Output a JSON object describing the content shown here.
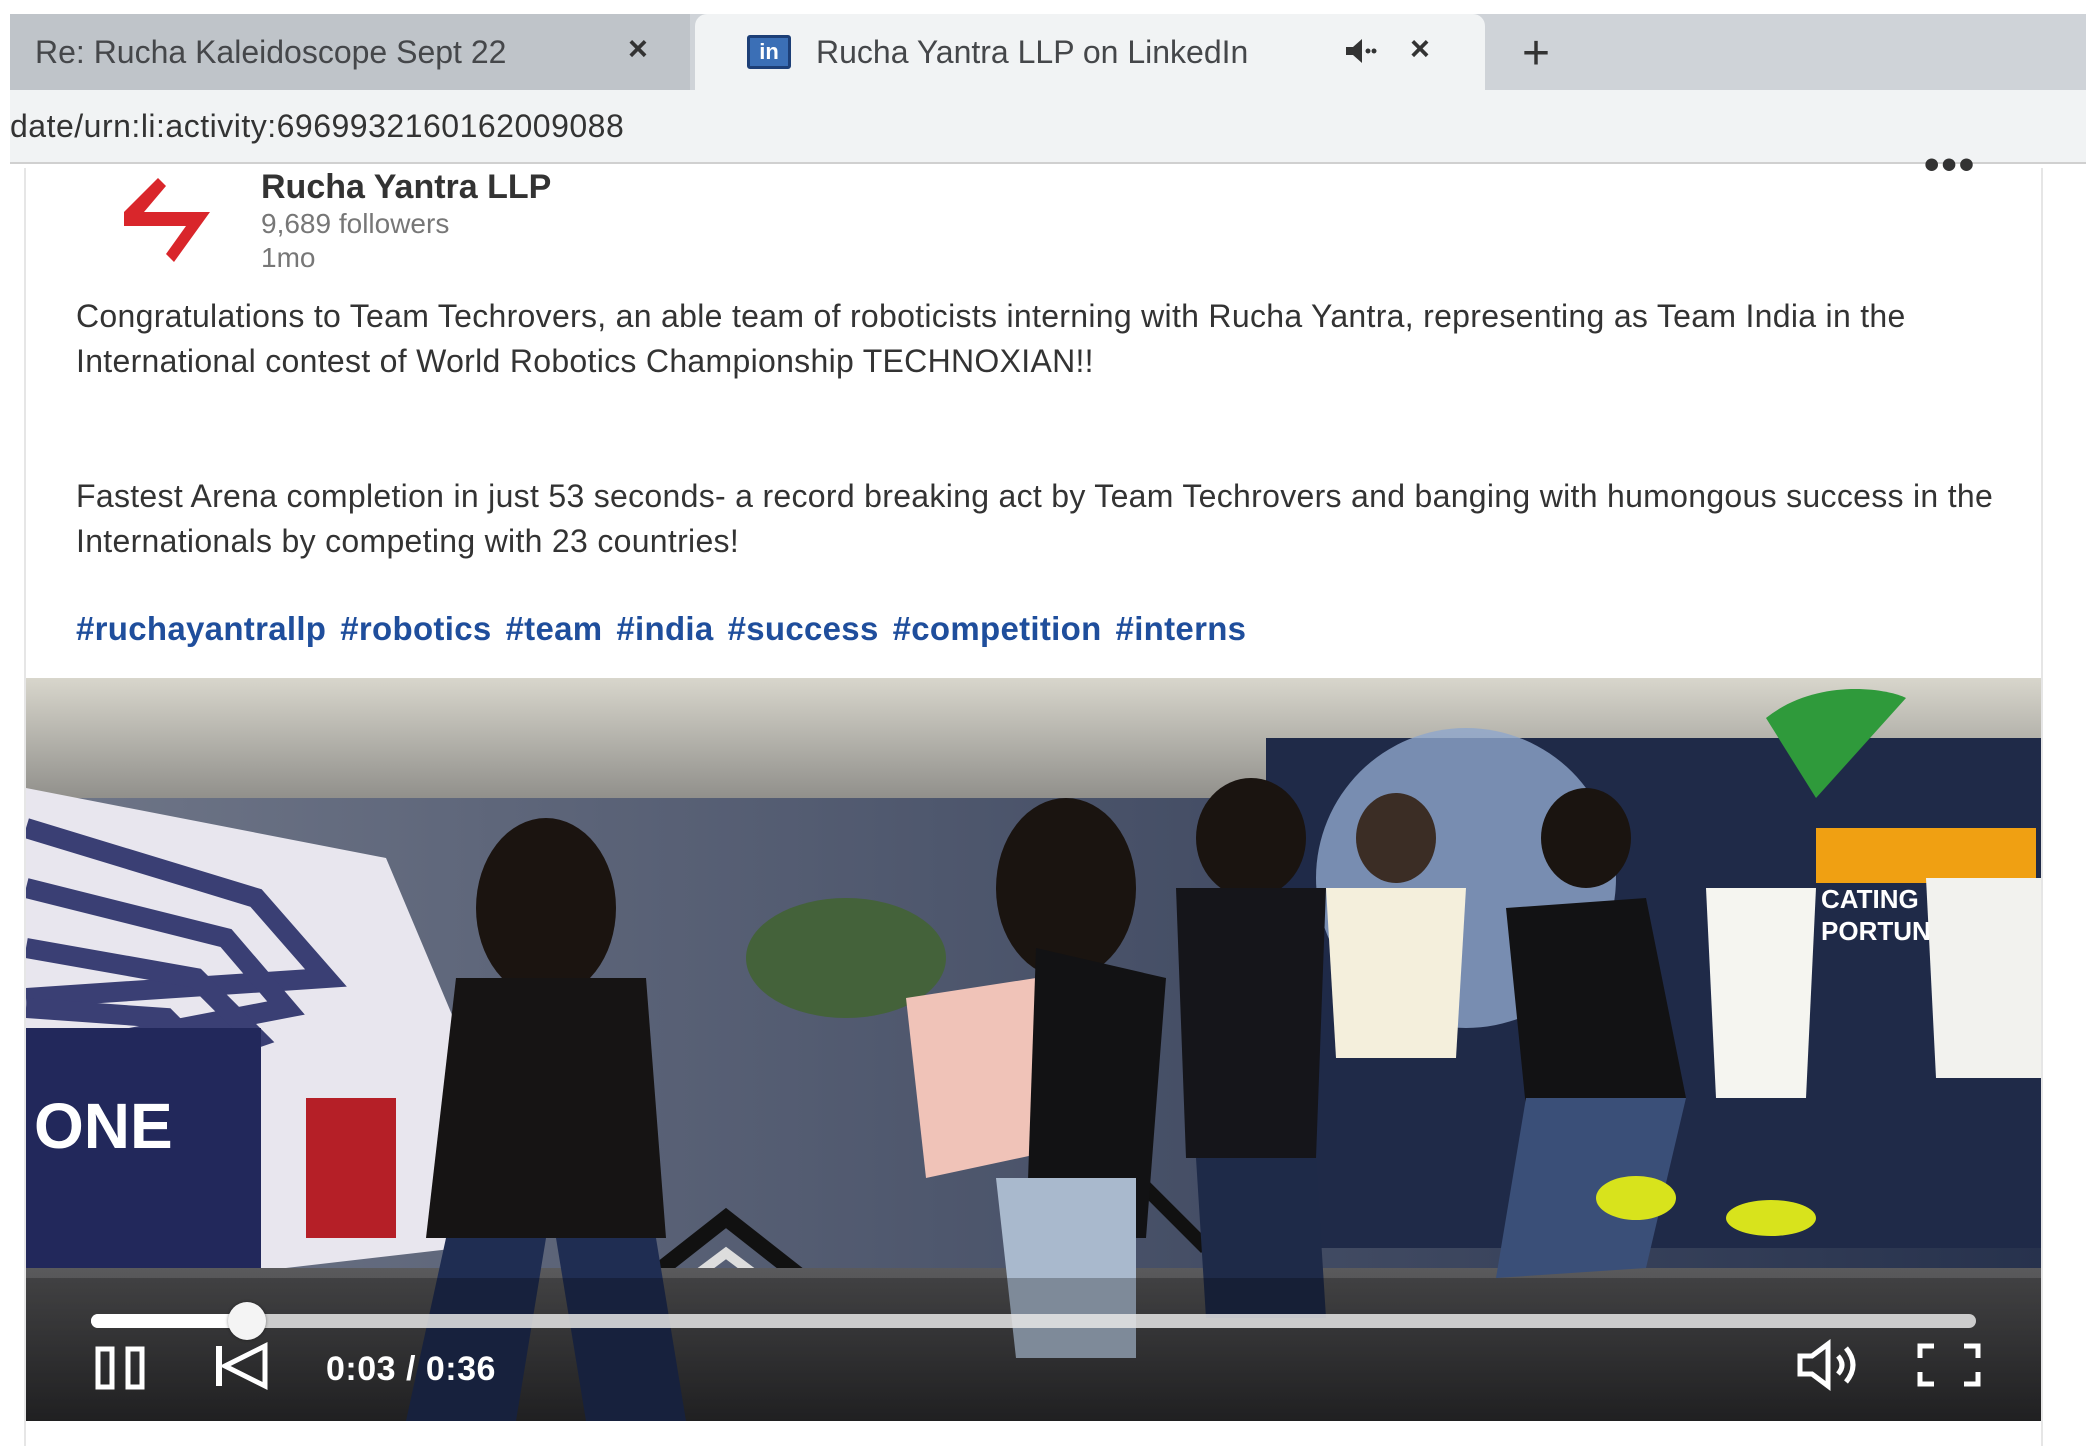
{
  "tabs": [
    {
      "title": "Re: Rucha Kaleidoscope Sept 22",
      "close": "×"
    },
    {
      "title": "Rucha Yantra LLP on LinkedIn",
      "close": "×",
      "favicon": "linkedin-icon",
      "audio": "speaker-muted-icon"
    }
  ],
  "new_tab_label": "+",
  "address_bar": {
    "url": "date/urn:li:activity:6969932160162009088"
  },
  "post": {
    "company": "Rucha Yantra LLP",
    "followers": "9,689 followers",
    "age": "1mo",
    "more_menu": "•••",
    "paragraph_1": "Congratulations to Team Techrovers, an able team of roboticists interning with Rucha Yantra, representing as Team India in the International contest of World Robotics Championship TECHNOXIAN!!",
    "paragraph_2": "Fastest Arena completion in just 53 seconds- a record breaking act by Team Techrovers and banging with humongous success in the Internationals by competing with 23 countries!",
    "hashtags": [
      "#ruchayantrallp",
      "#robotics",
      "#team",
      "#india",
      "#success",
      "#competition",
      "#interns"
    ]
  },
  "video": {
    "current_time": "0:03",
    "duration": "0:36",
    "time_display": "0:03 / 0:36",
    "progress_fraction": 0.083,
    "banner_text": "ONE",
    "sign_text": "CATING NEW PORTUNI"
  },
  "colors": {
    "accent": "#1f4e9c",
    "logo_red": "#d9262b",
    "linkedin_blue": "#3b6fb6"
  }
}
